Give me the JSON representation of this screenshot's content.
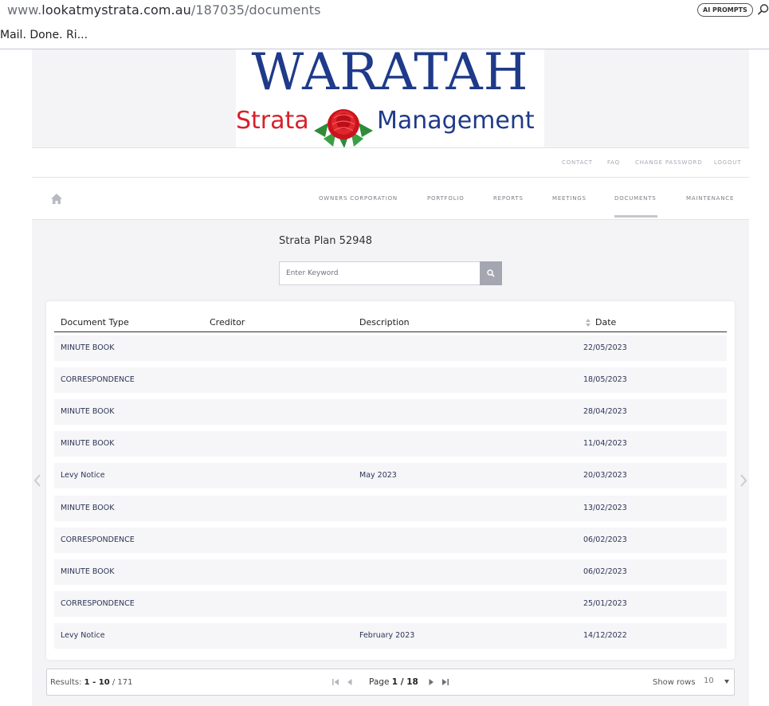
{
  "browser": {
    "url_prefix": "www.",
    "url_host": "lookatmystrata.com.au",
    "url_path": "/187035/documents",
    "ai_button": "AI PROMPTS",
    "bookmark": "Mail. Done. Ri..."
  },
  "logo": {
    "title": "WARATAH",
    "word_left": "Strata",
    "word_right": "Management"
  },
  "topnav": [
    "CONTACT",
    "FAQ",
    "CHANGE PASSWORD",
    "LOGOUT"
  ],
  "mainnav": [
    "OWNERS CORPORATION",
    "PORTFOLIO",
    "REPORTS",
    "MEETINGS",
    "DOCUMENTS",
    "MAINTENANCE"
  ],
  "active_nav": "DOCUMENTS",
  "plan_title": "Strata Plan 52948",
  "search": {
    "placeholder": "Enter Keyword"
  },
  "table": {
    "headers": [
      "Document Type",
      "Creditor",
      "Description",
      "Date"
    ],
    "rows": [
      [
        "MINUTE BOOK",
        "",
        "",
        "22/05/2023"
      ],
      [
        "CORRESPONDENCE",
        "",
        "",
        "18/05/2023"
      ],
      [
        "MINUTE BOOK",
        "",
        "",
        "28/04/2023"
      ],
      [
        "MINUTE BOOK",
        "",
        "",
        "11/04/2023"
      ],
      [
        "Levy Notice",
        "",
        "May 2023",
        "20/03/2023"
      ],
      [
        "MINUTE BOOK",
        "",
        "",
        "13/02/2023"
      ],
      [
        "CORRESPONDENCE",
        "",
        "",
        "06/02/2023"
      ],
      [
        "MINUTE BOOK",
        "",
        "",
        "06/02/2023"
      ],
      [
        "CORRESPONDENCE",
        "",
        "",
        "25/01/2023"
      ],
      [
        "Levy Notice",
        "",
        "February 2023",
        "14/12/2022"
      ]
    ]
  },
  "pager": {
    "results_label": "Results:",
    "results_range": "1 - 10",
    "results_total": "/ 171",
    "page_label": "Page",
    "page_current": "1 / 18",
    "show_rows_label": "Show rows",
    "rows_value": "10"
  },
  "colors": {
    "brand_blue": "#1f3a8a",
    "brand_red": "#d8202a",
    "page_bg": "#f4f4f6"
  }
}
